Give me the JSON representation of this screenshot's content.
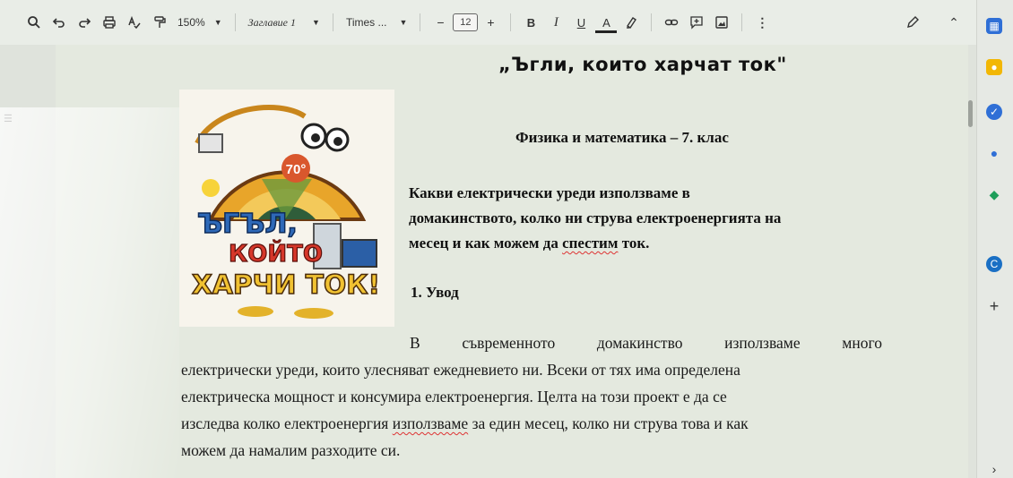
{
  "toolbar": {
    "zoom": "150%",
    "style": "Заглавие 1",
    "font": "Times ...",
    "font_size": "12",
    "minus": "−",
    "plus": "+",
    "bold": "B",
    "italic": "I",
    "underline": "U",
    "text_color": "A",
    "more": "⋮",
    "collapse": "⌃"
  },
  "document": {
    "title": "„Ъгли, които харчат ток\"",
    "cover_lines": [
      "ЪГЪЛ,",
      "КОЙТО",
      "ХАРЧИ ТОК!"
    ],
    "cover_temp": "70°",
    "subtitle": "Физика и математика – 7. клас",
    "question": {
      "line1": "Какви електрически уреди използваме в",
      "line2": "домакинството, колко ни струва електроенергията на",
      "line3_start": "месец и как можем да ",
      "line3_spell": "спестим",
      "line3_end": " ток."
    },
    "section_heading": "1. Увод",
    "paragraph": {
      "line1": [
        "В",
        "съвременното",
        "домакинство",
        "използваме",
        "много"
      ],
      "line2": "електрически уреди, които улесняват ежедневието ни. Всеки от тях има определена",
      "line3": "електрическа мощност и консумира електроенергия. Целта на този проект е да се",
      "line4_start": "изследва колко електроенергия ",
      "line4_spell": "използваме",
      "line4_end": " за един месец, колко ни струва това и как",
      "line5": "можем да намалим разходите си."
    }
  },
  "side_panel": {
    "add": "+",
    "expand": "›"
  },
  "colors": {
    "page_bg": "#e4e9df",
    "toolbar_bg": "#e9ede7",
    "spellcheck": "#d33"
  }
}
